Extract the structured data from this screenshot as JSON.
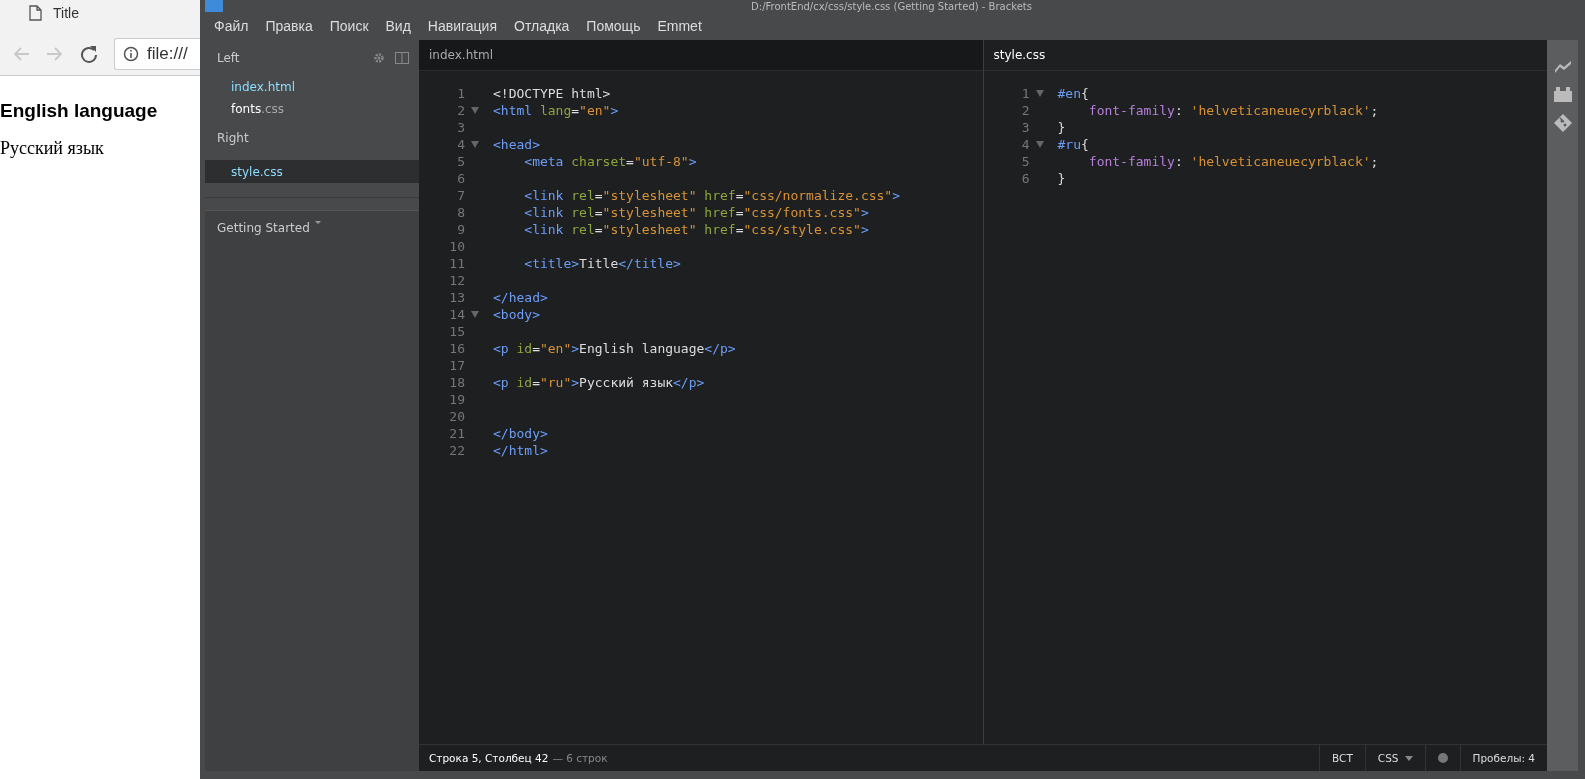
{
  "browser": {
    "tab_title": "Title",
    "address": "file:///",
    "content": [
      {
        "kind": "heading",
        "text": "English language"
      },
      {
        "kind": "paragraph",
        "text": "Русский язык"
      }
    ]
  },
  "window": {
    "title": "D:/FrontEnd/cx/css/style.css (Getting Started) - Brackets"
  },
  "menu": [
    "Файл",
    "Правка",
    "Поиск",
    "Вид",
    "Навигация",
    "Отладка",
    "Помощь",
    "Emmet"
  ],
  "sidebar": {
    "groups": [
      {
        "label": "Left",
        "files": [
          {
            "name": "index",
            "extension": ".html",
            "open": true,
            "selected": false
          },
          {
            "name": "fonts",
            "extension": ".css",
            "open": false,
            "selected": false
          }
        ]
      },
      {
        "label": "Right",
        "files": [
          {
            "name": "style",
            "extension": ".css",
            "open": true,
            "selected": true
          }
        ]
      }
    ],
    "project": "Getting Started"
  },
  "panes": [
    {
      "filename": "index.html",
      "focused": false,
      "lines": [
        {
          "number": "1",
          "fold": false,
          "tokens": [
            {
              "kind": "plain",
              "text": "<!DOCTYPE html>"
            }
          ]
        },
        {
          "number": "2",
          "fold": true,
          "tokens": [
            {
              "kind": "tag",
              "text": "<html"
            },
            {
              "kind": "attr",
              "text": " lang"
            },
            {
              "kind": "plain",
              "text": "="
            },
            {
              "kind": "string",
              "text": "\"en\""
            },
            {
              "kind": "tag",
              "text": ">"
            }
          ]
        },
        {
          "number": "3",
          "fold": false
        },
        {
          "number": "4",
          "fold": true,
          "tokens": [
            {
              "kind": "tag",
              "text": "<head>"
            }
          ]
        },
        {
          "number": "5",
          "fold": false,
          "tokens": [
            {
              "kind": "tag",
              "text": "    <meta"
            },
            {
              "kind": "attr",
              "text": " charset"
            },
            {
              "kind": "plain",
              "text": "="
            },
            {
              "kind": "string",
              "text": "\"utf-8\""
            },
            {
              "kind": "tag",
              "text": ">"
            }
          ]
        },
        {
          "number": "6",
          "fold": false
        },
        {
          "number": "7",
          "fold": false,
          "tokens": [
            {
              "kind": "tag",
              "text": "    <link"
            },
            {
              "kind": "attr",
              "text": " rel"
            },
            {
              "kind": "plain",
              "text": "="
            },
            {
              "kind": "string",
              "text": "\"stylesheet\""
            },
            {
              "kind": "attr",
              "text": " href"
            },
            {
              "kind": "plain",
              "text": "="
            },
            {
              "kind": "string",
              "text": "\"css/normalize.css\""
            },
            {
              "kind": "tag",
              "text": ">"
            }
          ]
        },
        {
          "number": "8",
          "fold": false,
          "tokens": [
            {
              "kind": "tag",
              "text": "    <link"
            },
            {
              "kind": "attr",
              "text": " rel"
            },
            {
              "kind": "plain",
              "text": "="
            },
            {
              "kind": "string",
              "text": "\"stylesheet\""
            },
            {
              "kind": "attr",
              "text": " href"
            },
            {
              "kind": "plain",
              "text": "="
            },
            {
              "kind": "string",
              "text": "\"css/fonts.css\""
            },
            {
              "kind": "tag",
              "text": ">"
            }
          ]
        },
        {
          "number": "9",
          "fold": false,
          "tokens": [
            {
              "kind": "tag",
              "text": "    <link"
            },
            {
              "kind": "attr",
              "text": " rel"
            },
            {
              "kind": "plain",
              "text": "="
            },
            {
              "kind": "string",
              "text": "\"stylesheet\""
            },
            {
              "kind": "attr",
              "text": " href"
            },
            {
              "kind": "plain",
              "text": "="
            },
            {
              "kind": "string",
              "text": "\"css/style.css\""
            },
            {
              "kind": "tag",
              "text": ">"
            }
          ]
        },
        {
          "number": "10",
          "fold": false
        },
        {
          "number": "11",
          "fold": false,
          "tokens": [
            {
              "kind": "tag",
              "text": "    <title>"
            },
            {
              "kind": "plain",
              "text": "Title"
            },
            {
              "kind": "tag",
              "text": "</title>"
            }
          ]
        },
        {
          "number": "12",
          "fold": false
        },
        {
          "number": "13",
          "fold": false,
          "tokens": [
            {
              "kind": "tag",
              "text": "</head>"
            }
          ]
        },
        {
          "number": "14",
          "fold": true,
          "tokens": [
            {
              "kind": "tag",
              "text": "<body>"
            }
          ]
        },
        {
          "number": "15",
          "fold": false
        },
        {
          "number": "16",
          "fold": false,
          "tokens": [
            {
              "kind": "tag",
              "text": "<p"
            },
            {
              "kind": "attr",
              "text": " id"
            },
            {
              "kind": "plain",
              "text": "="
            },
            {
              "kind": "string",
              "text": "\"en\""
            },
            {
              "kind": "tag",
              "text": ">"
            },
            {
              "kind": "plain",
              "text": "English language"
            },
            {
              "kind": "tag",
              "text": "</p>"
            }
          ]
        },
        {
          "number": "17",
          "fold": false
        },
        {
          "number": "18",
          "fold": false,
          "tokens": [
            {
              "kind": "tag",
              "text": "<p"
            },
            {
              "kind": "attr",
              "text": " id"
            },
            {
              "kind": "plain",
              "text": "="
            },
            {
              "kind": "string",
              "text": "\"ru\""
            },
            {
              "kind": "tag",
              "text": ">"
            },
            {
              "kind": "plain",
              "text": "Русский язык"
            },
            {
              "kind": "tag",
              "text": "</p>"
            }
          ]
        },
        {
          "number": "19",
          "fold": false
        },
        {
          "number": "20",
          "fold": false
        },
        {
          "number": "21",
          "fold": false,
          "tokens": [
            {
              "kind": "tag",
              "text": "</body>"
            }
          ]
        },
        {
          "number": "22",
          "fold": false,
          "tokens": [
            {
              "kind": "tag",
              "text": "</html>"
            }
          ]
        }
      ]
    },
    {
      "filename": "style.css",
      "focused": true,
      "lines": [
        {
          "number": "1",
          "fold": true,
          "tokens": [
            {
              "kind": "selector",
              "text": "#en"
            },
            {
              "kind": "plain",
              "text": "{"
            }
          ]
        },
        {
          "number": "2",
          "fold": false,
          "tokens": [
            {
              "kind": "property",
              "text": "    font-family"
            },
            {
              "kind": "plain",
              "text": ": "
            },
            {
              "kind": "string",
              "text": "'helveticaneuecyrblack'"
            },
            {
              "kind": "plain",
              "text": ";"
            }
          ]
        },
        {
          "number": "3",
          "fold": false,
          "tokens": [
            {
              "kind": "plain",
              "text": "}"
            }
          ]
        },
        {
          "number": "4",
          "fold": true,
          "tokens": [
            {
              "kind": "selector",
              "text": "#ru"
            },
            {
              "kind": "plain",
              "text": "{"
            }
          ]
        },
        {
          "number": "5",
          "fold": false,
          "tokens": [
            {
              "kind": "property",
              "text": "    font-family"
            },
            {
              "kind": "plain",
              "text": ": "
            },
            {
              "kind": "string",
              "text": "'helveticaneuecyrblack'"
            },
            {
              "kind": "plain",
              "text": ";"
            }
          ]
        },
        {
          "number": "6",
          "fold": false,
          "tokens": [
            {
              "kind": "plain",
              "text": "}"
            }
          ]
        }
      ]
    }
  ],
  "status_bar": {
    "cursor": "Строка 5, Столбец 42",
    "line_count": "— 6 строк",
    "mode": "ВСТ",
    "language": "CSS",
    "spaces": "Пробелы: 4"
  }
}
